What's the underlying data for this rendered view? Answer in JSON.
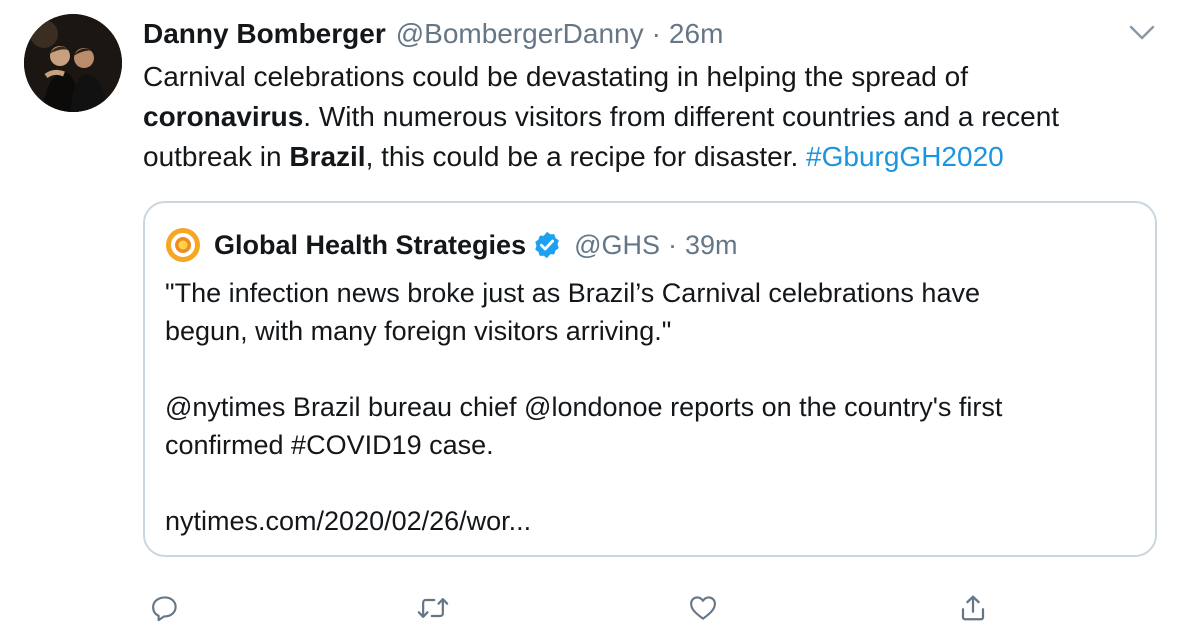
{
  "tweet": {
    "display_name": "Danny Bomberger",
    "handle": "@BombergerDanny",
    "separator": "·",
    "time": "26m",
    "text_lines": [
      {
        "a": "Carnival celebrations could be devastating in helping the spread of"
      },
      {
        "b": "coronavirus",
        "a": ". With numerous visitors from different countries and a recent"
      },
      {
        "a": "outbreak in ",
        "b": "Brazil",
        "c": ", this could be a recipe for disaster. ",
        "hashtag": "#GburgGH2020"
      }
    ]
  },
  "quoted_tweet": {
    "display_name": "Global Health Strategies",
    "handle": "@GHS",
    "separator": "·",
    "time": "39m",
    "paragraph1": [
      "\"The infection news broke just as Brazil’s Carnival celebrations have",
      "begun, with many foreign visitors arriving.\""
    ],
    "paragraph2": [
      "@nytimes Brazil bureau chief @londonoe reports on the country's first",
      "confirmed #COVID19 case."
    ],
    "link": "nytimes.com/2020/02/26/wor..."
  },
  "colors": {
    "text": "#14171a",
    "secondary": "#657786",
    "accent": "#1b95e0",
    "verified": "#1da1f2",
    "border": "#ccd6dd"
  },
  "actions": [
    "reply-icon",
    "retweet-icon",
    "like-icon",
    "share-icon"
  ]
}
